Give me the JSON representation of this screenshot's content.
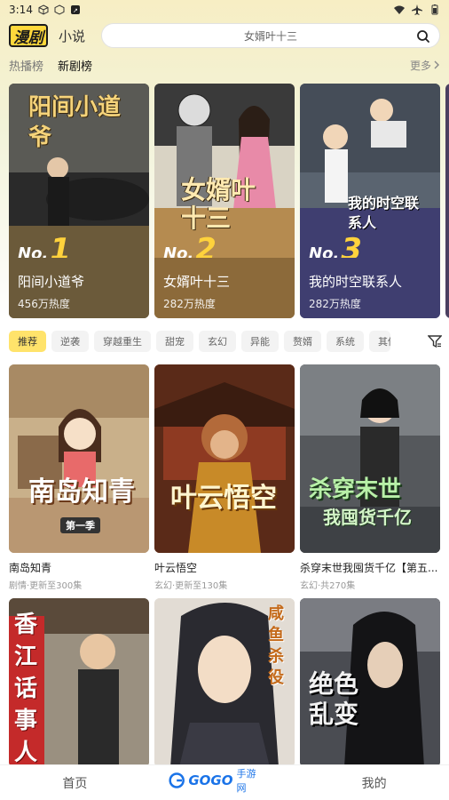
{
  "status_bar": {
    "time": "3:14"
  },
  "header": {
    "logo": "漫剧",
    "novel_tab": "小说",
    "search_placeholder": "女婿叶十三"
  },
  "rank_tabs": {
    "tabs": [
      "热播榜",
      "新剧榜"
    ],
    "active": 1,
    "more": "更多"
  },
  "rankings": [
    {
      "no_prefix": "No.",
      "rank": "1",
      "title": "阳间小道爷",
      "heat": "456万热度",
      "cover_text": "阳间小道爷",
      "theme": "#6b5a3a"
    },
    {
      "no_prefix": "No.",
      "rank": "2",
      "title": "女婿叶十三",
      "heat": "282万热度",
      "cover_text": "女婿叶十三",
      "theme": "#8c6a3a"
    },
    {
      "no_prefix": "No.",
      "rank": "3",
      "title": "我的时空联系人",
      "heat": "282万热度",
      "cover_text": "我的时空联系人",
      "theme": "#3f3e70"
    }
  ],
  "tags": [
    "推荐",
    "逆袭",
    "穿越重生",
    "甜宠",
    "玄幻",
    "异能",
    "赘婿",
    "系统",
    "其他"
  ],
  "grid": [
    {
      "title": "南岛知青",
      "meta": "剧情·更新至300集",
      "cover_text": "南岛知青",
      "sub": "第一季"
    },
    {
      "title": "叶云悟空",
      "meta": "玄幻·更新至130集",
      "cover_text": "叶云悟空"
    },
    {
      "title": "杀穿末世我囤货千亿【第五...",
      "meta": "玄幻·共270集",
      "cover_text": "杀穿末世",
      "sub": "我囤货千亿"
    },
    {
      "title": "",
      "meta": "",
      "cover_text": "香江话事人"
    },
    {
      "title": "",
      "meta": "",
      "cover_text": "咸鱼杀役"
    },
    {
      "title": "",
      "meta": "",
      "cover_text": "绝色乱变"
    }
  ],
  "bottom_nav": {
    "home": "首页",
    "mine": "我的"
  },
  "watermark": {
    "brand": "GOGO",
    "text": "手游网"
  }
}
